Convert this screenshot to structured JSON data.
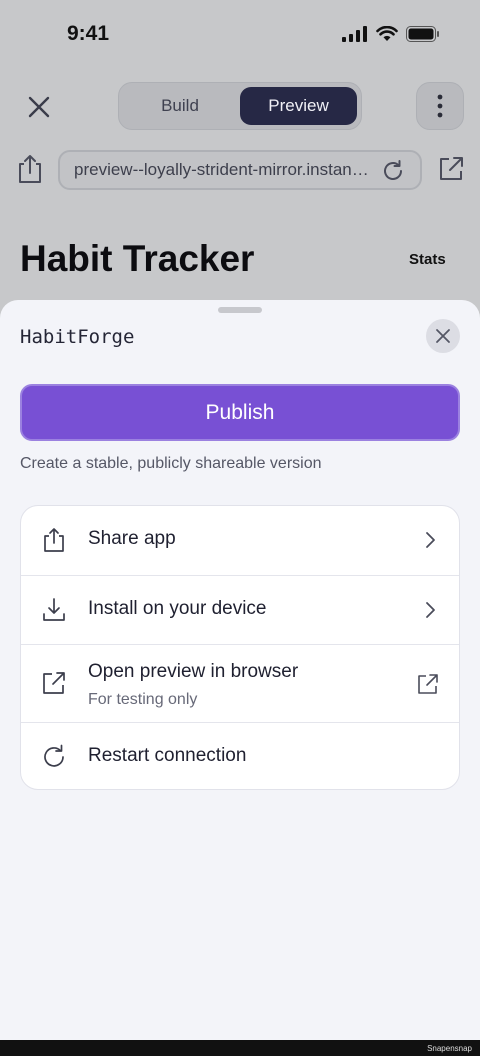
{
  "status": {
    "time": "9:41"
  },
  "browser": {
    "tabs": [
      {
        "label": "Build"
      },
      {
        "label": "Preview"
      }
    ],
    "url": "preview--loyally-strident-mirror.instant.app"
  },
  "app": {
    "title": "Habit Tracker",
    "stats_label": "Stats"
  },
  "sheet": {
    "title": "HabitForge",
    "publish_label": "Publish",
    "publish_description": "Create a stable, publicly shareable version",
    "items": [
      {
        "label": "Share app",
        "icon": "share-icon"
      },
      {
        "label": "Install on your device",
        "icon": "download-icon"
      },
      {
        "label": "Open preview in browser",
        "sublabel": "For testing only",
        "icon": "external-link-icon"
      },
      {
        "label": "Restart connection",
        "icon": "refresh-icon"
      }
    ]
  },
  "footer": {
    "watermark": "Snapensnap"
  },
  "colors": {
    "accent": "#7850d4",
    "segment_active": "#262845",
    "sheet_bg": "#f3f4f9"
  }
}
